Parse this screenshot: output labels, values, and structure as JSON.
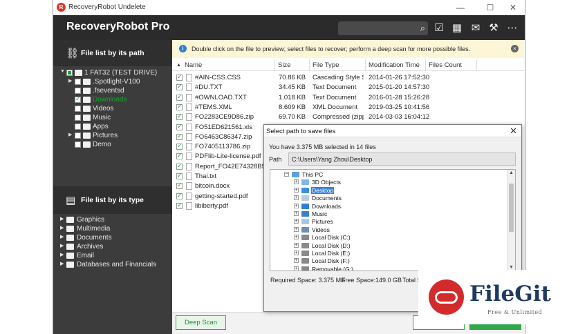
{
  "window": {
    "title": "RecoveryRobot Undelete",
    "min": "—",
    "max": "☐",
    "close": "✕"
  },
  "header": {
    "app_name": "RecoveryRobot Pro"
  },
  "left": {
    "path_title": "File list by its path",
    "tree": [
      {
        "label": "1 FAT32 (TEST DRIVE)",
        "depth": 0,
        "arrow": "▼",
        "cb": "partial"
      },
      {
        "label": ".Spotlight-V100",
        "depth": 1,
        "arrow": "▶",
        "cb": "none"
      },
      {
        "label": ".fseventsd",
        "depth": 1,
        "arrow": "",
        "cb": "none"
      },
      {
        "label": "Downloads",
        "depth": 1,
        "arrow": "",
        "cb": "checked",
        "highlight": true
      },
      {
        "label": "Videos",
        "depth": 1,
        "arrow": "",
        "cb": "none"
      },
      {
        "label": "Music",
        "depth": 1,
        "arrow": "",
        "cb": "none"
      },
      {
        "label": "Apps",
        "depth": 1,
        "arrow": "",
        "cb": "none"
      },
      {
        "label": "Pictures",
        "depth": 1,
        "arrow": "▶",
        "cb": "none"
      },
      {
        "label": "Demo",
        "depth": 1,
        "arrow": "",
        "cb": "none"
      }
    ],
    "type_title": "File list by its type",
    "types": [
      "Graphics",
      "Multimedia",
      "Documents",
      "Archives",
      "Email",
      "Databases and Financials"
    ]
  },
  "infobar": {
    "text": "Double click on the file to preview; select files to recover; perform a deep scan for more possible files."
  },
  "columns": {
    "name": "Name",
    "size": "Size",
    "type": "File Type",
    "time": "Modification Time",
    "count": "Files Count"
  },
  "files": [
    {
      "name": "#AIN-CSS.CSS",
      "size": "70.86 KB",
      "type": "Cascading Style Sh...",
      "time": "2014-01-26 17:52:30"
    },
    {
      "name": "#DU.TXT",
      "size": "34.45 KB",
      "type": "Text Document",
      "time": "2015-01-20 14:57:30"
    },
    {
      "name": "#OWNLOAD.TXT",
      "size": "1.018 KB",
      "type": "Text Document",
      "time": "2016-01-28 15:26:28"
    },
    {
      "name": "#TEMS.XML",
      "size": "8.609 KB",
      "type": "XML Document",
      "time": "2019-03-25 10:41:56"
    },
    {
      "name": "FO2283CE9D86.zip",
      "size": "69.70 KB",
      "type": "Compressed (zippe...",
      "time": "2014-03-03 16:04:12"
    },
    {
      "name": "FO51ED621561.xls",
      "size": "",
      "type": "",
      "time": ""
    },
    {
      "name": "FO6463C86347.zip",
      "size": "",
      "type": "",
      "time": ""
    },
    {
      "name": "FO7405113786.zip",
      "size": "",
      "type": "",
      "time": ""
    },
    {
      "name": "PDFlib-Lite-license.pdf",
      "size": "",
      "type": "",
      "time": ""
    },
    {
      "name": "Report_FO42E74328B5.xls",
      "size": "",
      "type": "",
      "time": ""
    },
    {
      "name": "Thai.txt",
      "size": "",
      "type": "",
      "time": ""
    },
    {
      "name": "bitcoin.docx",
      "size": "",
      "type": "",
      "time": ""
    },
    {
      "name": "getting-started.pdf",
      "size": "",
      "type": "",
      "time": ""
    },
    {
      "name": "libiberty.pdf",
      "size": "",
      "type": "",
      "time": ""
    }
  ],
  "bottom": {
    "deep_scan": "Deep Scan"
  },
  "dialog": {
    "title": "Select path to save files",
    "close": "✕",
    "selected_info": "You have 3.375 MB selected in 14 files",
    "path_label": "Path",
    "path_value": "C:\\Users\\Yang Zhou\\Desktop",
    "tree": [
      {
        "label": "This PC",
        "depth": 0,
        "exp": "−",
        "color": "#5aa0e0"
      },
      {
        "label": "3D Objects",
        "depth": 1,
        "exp": "+",
        "color": "#7fb7e8"
      },
      {
        "label": "Desktop",
        "depth": 1,
        "exp": "+",
        "color": "#3b8fe0",
        "selected": true
      },
      {
        "label": "Documents",
        "depth": 1,
        "exp": "+",
        "color": "#b9cbe0"
      },
      {
        "label": "Downloads",
        "depth": 1,
        "exp": "+",
        "color": "#2f7fd6"
      },
      {
        "label": "Music",
        "depth": 1,
        "exp": "+",
        "color": "#3b7fd0"
      },
      {
        "label": "Pictures",
        "depth": 1,
        "exp": "+",
        "color": "#a9c7e4"
      },
      {
        "label": "Videos",
        "depth": 1,
        "exp": "+",
        "color": "#6f8fb3"
      },
      {
        "label": "Local Disk (C:)",
        "depth": 1,
        "exp": "+",
        "color": "#8a8a8a"
      },
      {
        "label": "Local Disk (D:)",
        "depth": 1,
        "exp": "+",
        "color": "#8a8a8a"
      },
      {
        "label": "Local Disk (E:)",
        "depth": 1,
        "exp": "+",
        "color": "#8a8a8a"
      },
      {
        "label": "Local Disk (F:)",
        "depth": 1,
        "exp": "+",
        "color": "#8a8a8a"
      },
      {
        "label": "Removable (G:)",
        "depth": 1,
        "exp": "+",
        "color": "#8a8a8a"
      }
    ],
    "required": "Required Space: 3.375 MB",
    "free": "Free Space:149.0 GB",
    "total": "Total Sp"
  },
  "watermark": {
    "name": "FileGit",
    "tagline": "Free & Unlimited"
  },
  "colors": {
    "accent_green": "#2fa84a",
    "header": "#2b2b2b",
    "panel": "#3c3c3c",
    "highlight_green": "#1aa334"
  }
}
